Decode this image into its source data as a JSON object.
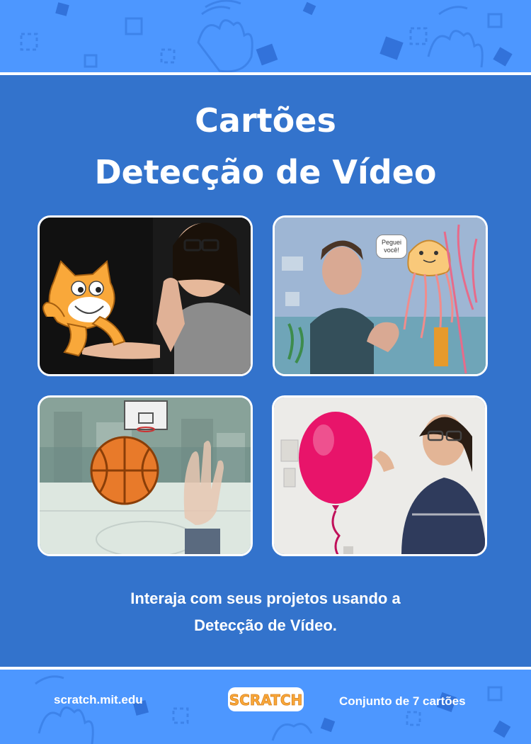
{
  "title": {
    "line1": "Cartões",
    "line2": "Detecção de Vídeo"
  },
  "tagline": {
    "line1": "Interaja com seus projetos usando a",
    "line2": "Detecção de Vídeo."
  },
  "cards": [
    {
      "name": "cat-and-waving-hand",
      "speech": ""
    },
    {
      "name": "jellyfish-underwater",
      "speech": "Peguei você!"
    },
    {
      "name": "basketball-court",
      "speech": ""
    },
    {
      "name": "balloon-pop",
      "speech": ""
    }
  ],
  "footer": {
    "url": "scratch.mit.edu",
    "logo": "SCRATCH",
    "set_count": "Conjunto de 7 cartões"
  },
  "colors": {
    "band": "#4d97ff",
    "main": "#3373cc",
    "logo_orange": "#f9a83a"
  },
  "icons": [
    "hand-wave-icon",
    "square-dash-icon",
    "diamond-icon"
  ]
}
